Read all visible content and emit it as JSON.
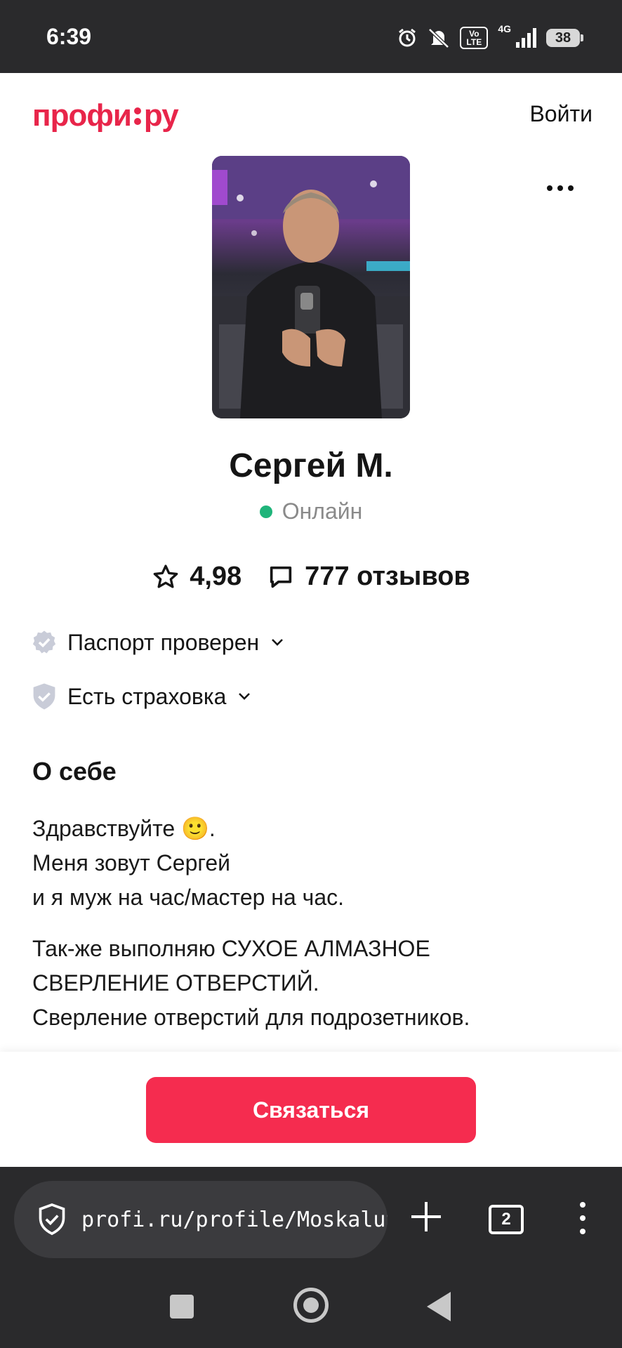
{
  "status_bar": {
    "time": "6:39",
    "volte_label": "Vo LTE",
    "network_label": "4G",
    "battery_level": "38",
    "icons": [
      "alarm-icon",
      "mute-icon",
      "volte-icon",
      "signal-icon",
      "battery-icon"
    ]
  },
  "header": {
    "logo_left": "профи",
    "logo_right": "ру",
    "login_label": "Войти"
  },
  "profile": {
    "name": "Сергей М.",
    "status": "Онлайн",
    "status_color": "#1fb47a",
    "rating": "4,98",
    "reviews": "777 отзывов"
  },
  "badges": [
    {
      "label": "Паспорт проверен",
      "icon": "verified-badge-icon"
    },
    {
      "label": "Есть страховка",
      "icon": "shield-check-icon"
    }
  ],
  "about": {
    "title": "О себе",
    "paragraphs": [
      [
        "Здравствуйте 🙂.",
        "Меня зовут Сергей",
        "и я муж на час/мастер на час."
      ],
      [
        "Так-же выполняю СУХОЕ АЛМАЗНОЕ",
        "СВЕРЛЕНИЕ ОТВЕРСТИЙ.",
        "Сверление отверстий для подрозетников."
      ]
    ]
  },
  "cta": {
    "contact_label": "Связаться",
    "color": "#f52c4f"
  },
  "browser": {
    "url": "profi.ru/profile/MoskaluS",
    "tab_count": "2"
  },
  "brand_color": "#e8254a"
}
